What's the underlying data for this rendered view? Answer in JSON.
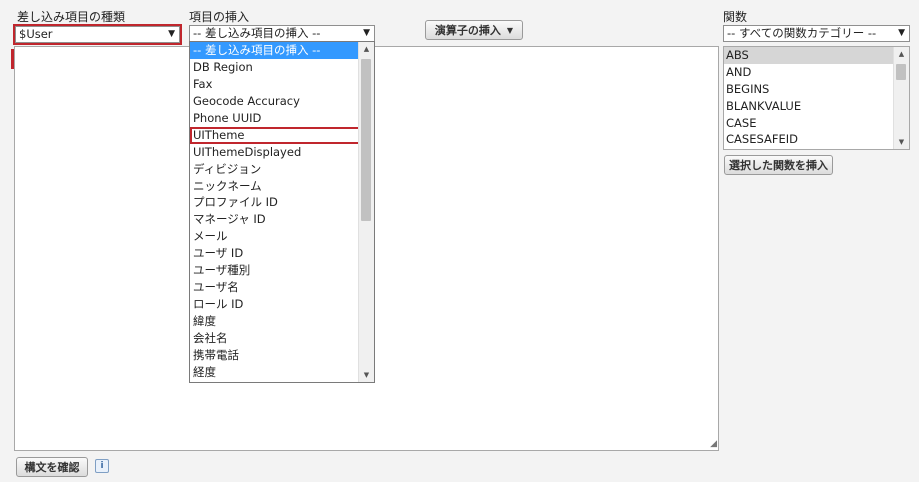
{
  "merge_type": {
    "label": "差し込み項目の種類",
    "value": "$User"
  },
  "insert_field": {
    "label": "項目の挿入",
    "value": "-- 差し込み項目の挿入 --",
    "options": [
      "-- 差し込み項目の挿入 --",
      "DB Region",
      "Fax",
      "Geocode Accuracy",
      "Phone UUID",
      "UITheme",
      "UIThemeDisplayed",
      "ディビジョン",
      "ニックネーム",
      "プロファイル ID",
      "マネージャ ID",
      "メール",
      "ユーザ ID",
      "ユーザ種別",
      "ユーザ名",
      "ロール ID",
      "緯度",
      "会社名",
      "携帯電話",
      "経度"
    ],
    "selected_index": 0,
    "highlighted_option": "UITheme"
  },
  "operator_button": {
    "label": "演算子の挿入",
    "arrow": "▼"
  },
  "functions": {
    "label": "関数",
    "category_value": "-- すべての関数カテゴリー --",
    "items": [
      "ABS",
      "AND",
      "BEGINS",
      "BLANKVALUE",
      "CASE",
      "CASESAFEID"
    ],
    "selected": "ABS",
    "insert_button": "選択した関数を挿入"
  },
  "check_syntax_button": "構文を確認",
  "info_icon_glyph": "i",
  "icons": {
    "dropdown_arrow": "▼",
    "scroll_up": "▲",
    "scroll_down": "▼",
    "resize_grip": "◢"
  },
  "colors": {
    "highlight": "#c0262d",
    "selection": "#3399ff",
    "background": "#f3f3f3"
  }
}
